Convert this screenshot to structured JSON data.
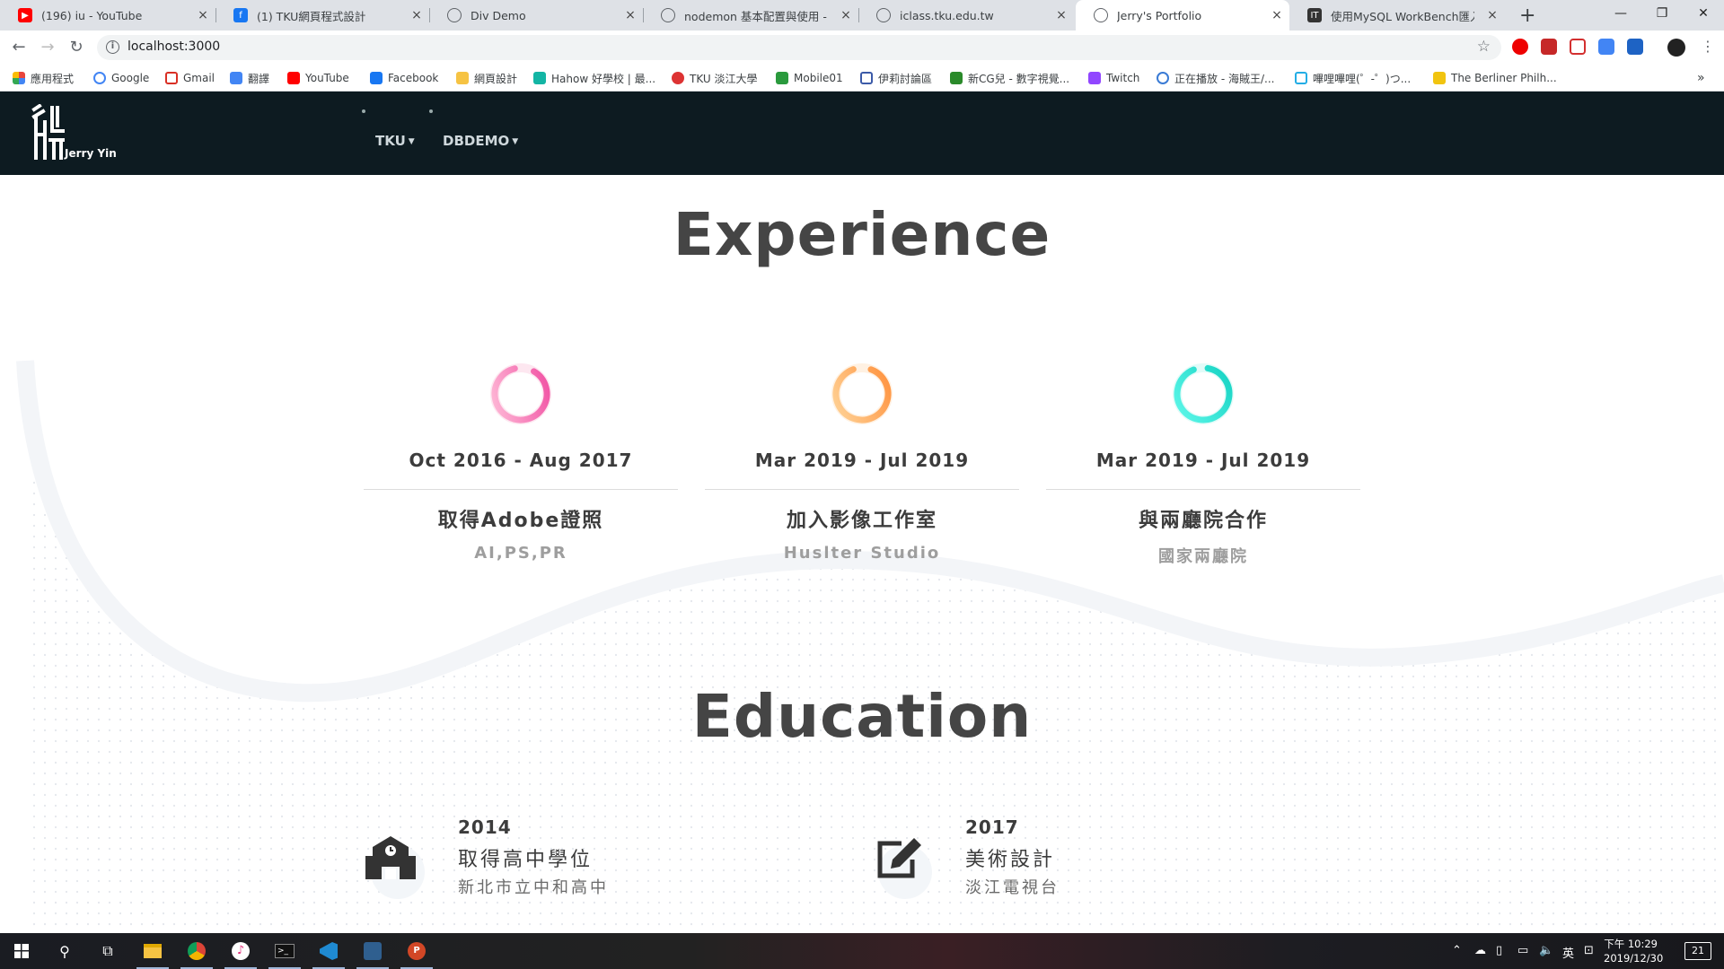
{
  "browser": {
    "tabs": [
      {
        "title": "(196) iu - YouTube",
        "icon": "youtube-icon",
        "color": "#ff0000"
      },
      {
        "title": "(1) TKU網頁程式設計",
        "icon": "facebook-icon",
        "color": "#1877f2"
      },
      {
        "title": "Div Demo",
        "icon": "globe-icon",
        "color": "#5f6368"
      },
      {
        "title": "nodemon 基本配置與使用 - 臺灣",
        "icon": "globe-icon",
        "color": "#5f6368"
      },
      {
        "title": "iclass.tku.edu.tw",
        "icon": "globe-icon",
        "color": "#5f6368"
      },
      {
        "title": "Jerry's Portfolio",
        "icon": "globe-icon",
        "color": "#5f6368",
        "active": true
      },
      {
        "title": "使用MySQL WorkBench匯入資料",
        "icon": "ithome-icon",
        "color": "#333333"
      }
    ],
    "url": "localhost:3000",
    "bookmarks": [
      {
        "label": "應用程式",
        "icon": "apps-grid-icon",
        "color": "#e8453c"
      },
      {
        "label": "Google",
        "icon": "google-icon",
        "color": "#4285f4"
      },
      {
        "label": "Gmail",
        "icon": "gmail-icon",
        "color": "#d93025"
      },
      {
        "label": "翻譯",
        "icon": "translate-icon",
        "color": "#4285f4"
      },
      {
        "label": "YouTube",
        "icon": "youtube-icon",
        "color": "#ff0000"
      },
      {
        "label": "Facebook",
        "icon": "facebook-icon",
        "color": "#1877f2"
      },
      {
        "label": "網頁設計",
        "icon": "folder-icon",
        "color": "#f6c343"
      },
      {
        "label": "Hahow 好學校 | 最...",
        "icon": "hahow-icon",
        "color": "#13b5a4"
      },
      {
        "label": "TKU 淡江大學",
        "icon": "tku-icon",
        "color": "#d33"
      },
      {
        "label": "Mobile01",
        "icon": "mobile01-icon",
        "color": "#2a9a3d"
      },
      {
        "label": "伊莉討論區",
        "icon": "eyny-icon",
        "color": "#3b5aa8"
      },
      {
        "label": "新CG兒 - 數字視覺...",
        "icon": "cg-icon",
        "color": "#2a8a2a"
      },
      {
        "label": "Twitch",
        "icon": "twitch-icon",
        "color": "#9146ff"
      },
      {
        "label": "正在播放 - 海賊王/...",
        "icon": "anime-icon",
        "color": "#3a7bd5"
      },
      {
        "label": "嗶哩嗶哩(゜-゜)つ...",
        "icon": "bilibili-icon",
        "color": "#23ade5"
      },
      {
        "label": "The Berliner Philh...",
        "icon": "berliner-icon",
        "color": "#f1c40f"
      }
    ]
  },
  "site": {
    "logo_name": "Jerry Yin",
    "nav": [
      {
        "label": "TKU"
      },
      {
        "label": "DBDEMO"
      }
    ]
  },
  "experience": {
    "title": "Experience",
    "items": [
      {
        "date": "Oct 2016 - Aug 2017",
        "role": "取得Adobe證照",
        "org": "AI,PS,PR",
        "ring_color_a": "#ff6fa8",
        "ring_color_b": "#f04aa0"
      },
      {
        "date": "Mar 2019 - Jul 2019",
        "role": "加入影像工作室",
        "org": "Huslter Studio",
        "ring_color_a": "#ffb347",
        "ring_color_b": "#ff8f3a"
      },
      {
        "date": "Mar 2019 - Jul 2019",
        "role": "與兩廳院合作",
        "org": "國家兩廳院",
        "ring_color_a": "#3ff3e0",
        "ring_color_b": "#1fd6c8"
      }
    ]
  },
  "education": {
    "title": "Education",
    "items": [
      {
        "year": "2014",
        "title": "取得高中學位",
        "school": "新北市立中和高中",
        "icon": "school-icon"
      },
      {
        "year": "2017",
        "title": "美術設計",
        "school": "淡江電視台",
        "icon": "edit-icon"
      }
    ]
  },
  "taskbar": {
    "time": "下午 10:29",
    "date": "2019/12/30",
    "ime": "英",
    "notifications": "21"
  }
}
